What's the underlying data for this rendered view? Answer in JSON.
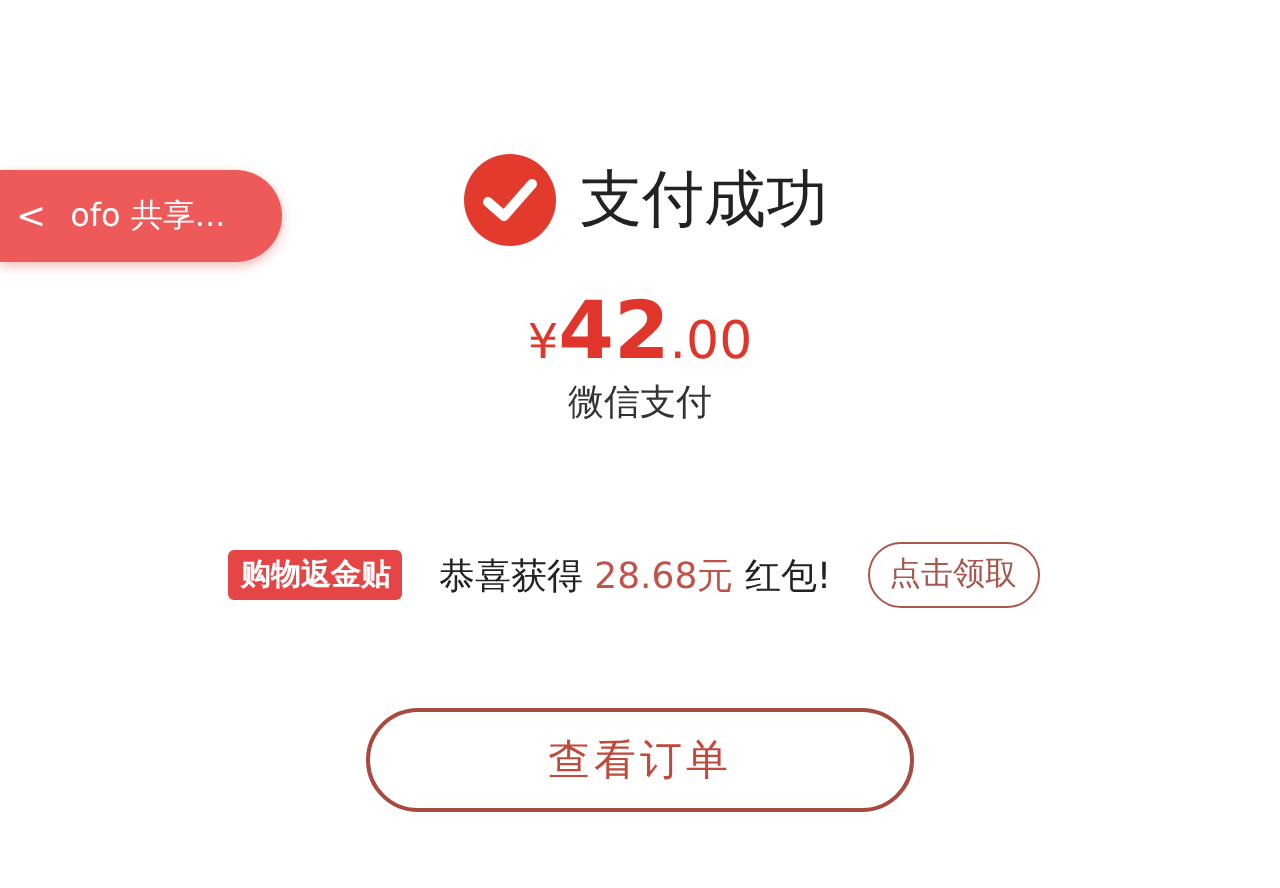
{
  "back_button": {
    "icon": "<",
    "label": "ofo 共享..."
  },
  "title": "支付成功",
  "payment": {
    "currency": "¥",
    "integer": "42",
    "decimal": ".00",
    "method": "微信支付"
  },
  "promotion": {
    "badge": "购物返金贴",
    "message": "恭喜获得 **28.68元** 红包!",
    "claim_button": "点击领取"
  },
  "order_button": "查看订单"
}
